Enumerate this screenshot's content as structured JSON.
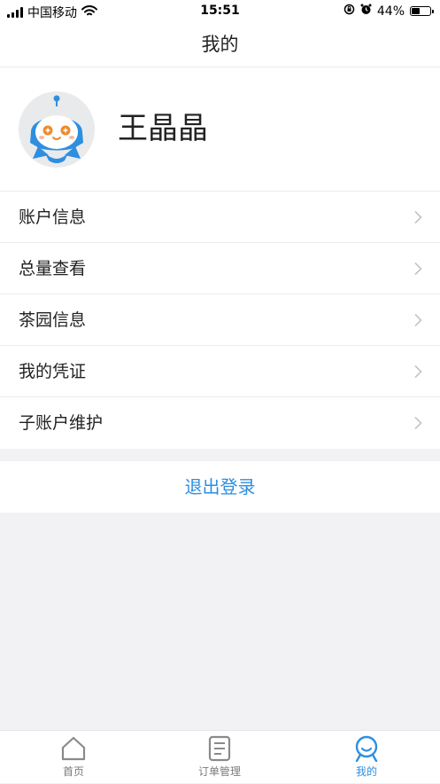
{
  "status_bar": {
    "carrier": "中国移动",
    "time": "15:51",
    "battery_percent": "44%",
    "battery_level": 0.44
  },
  "nav": {
    "title": "我的"
  },
  "profile": {
    "name": "王晶晶"
  },
  "menu": {
    "items": [
      {
        "label": "账户信息"
      },
      {
        "label": "总量查看"
      },
      {
        "label": "茶园信息"
      },
      {
        "label": "我的凭证"
      },
      {
        "label": "子账户维护"
      }
    ]
  },
  "logout_label": "退出登录",
  "tabbar": {
    "items": [
      {
        "label": "首页",
        "icon": "home-icon",
        "active": false
      },
      {
        "label": "订单管理",
        "icon": "order-icon",
        "active": false
      },
      {
        "label": "我的",
        "icon": "user-icon",
        "active": true
      }
    ]
  },
  "colors": {
    "accent": "#2e8ee0",
    "background": "#f2f2f5",
    "inactive_tab": "#7b7b7b"
  }
}
